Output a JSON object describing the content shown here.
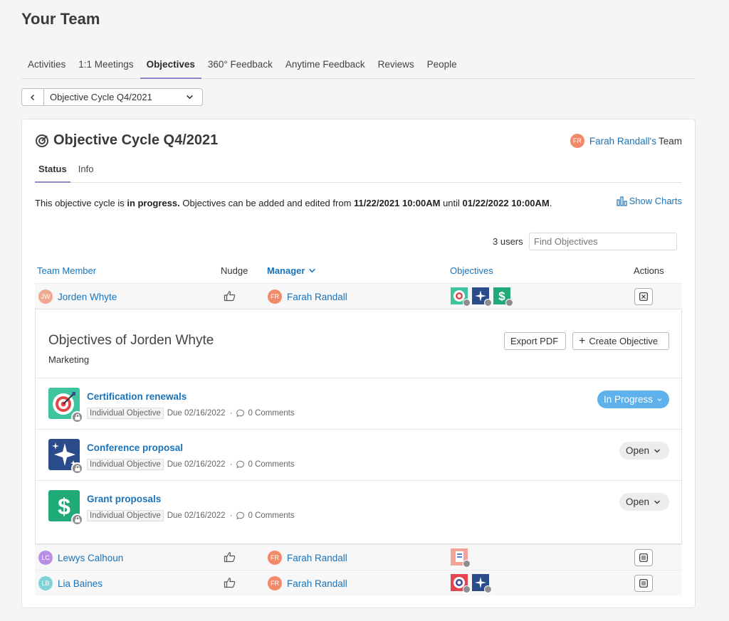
{
  "page": {
    "title": "Your Team"
  },
  "tabs": [
    {
      "label": "Activities",
      "active": false
    },
    {
      "label": "1:1 Meetings",
      "active": false
    },
    {
      "label": "Objectives",
      "active": true
    },
    {
      "label": "360° Feedback",
      "active": false
    },
    {
      "label": "Anytime Feedback",
      "active": false
    },
    {
      "label": "Reviews",
      "active": false
    },
    {
      "label": "People",
      "active": false
    }
  ],
  "cycle_selector": {
    "value": "Objective Cycle Q4/2021"
  },
  "cycle": {
    "title": "Objective Cycle Q4/2021",
    "owner_initials": "FR",
    "owner_name": "Farah Randall's",
    "owner_suffix": "Team",
    "subtabs": [
      {
        "label": "Status",
        "active": true
      },
      {
        "label": "Info",
        "active": false
      }
    ],
    "status": {
      "p1": "This objective cycle is ",
      "b1": "in progress.",
      "p2": " Objectives can be added and edited from ",
      "b2": "11/22/2021 10:00AM",
      "p3": " until ",
      "b3": "01/22/2022 10:00AM",
      "p4": "."
    },
    "show_charts": "Show Charts"
  },
  "list": {
    "users_count": "3 users",
    "search_placeholder": "Find Objectives",
    "headers": {
      "member": "Team Member",
      "nudge": "Nudge",
      "manager": "Manager",
      "objectives": "Objectives",
      "actions": "Actions"
    },
    "rows": [
      {
        "initials": "JW",
        "name": "Jorden Whyte",
        "manager_initials": "FR",
        "manager": "Farah Randall"
      },
      {
        "initials": "LC",
        "name": "Lewys Calhoun",
        "manager_initials": "FR",
        "manager": "Farah Randall"
      },
      {
        "initials": "LB",
        "name": "Lia Baines",
        "manager_initials": "FR",
        "manager": "Farah Randall"
      }
    ]
  },
  "detail": {
    "title": "Objectives of Jorden Whyte",
    "subtitle": "Marketing",
    "export_label": "Export PDF",
    "create_label": "Create Objective",
    "objectives": [
      {
        "name": "Certification renewals",
        "type": "Individual Objective",
        "due": "Due 02/16/2022",
        "comments": "0 Comments",
        "status": "In Progress",
        "icon": "target-icon"
      },
      {
        "name": "Conference proposal",
        "type": "Individual Objective",
        "due": "Due 02/16/2022",
        "comments": "0 Comments",
        "status": "Open",
        "icon": "sparkles-icon"
      },
      {
        "name": "Grant proposals",
        "type": "Individual Objective",
        "due": "Due 02/16/2022",
        "comments": "0 Comments",
        "status": "Open",
        "icon": "dollar-icon"
      }
    ]
  },
  "colors": {
    "link": "#1a73b8",
    "tab_underline": "#8e88c8",
    "in_progress": "#5fb1ec",
    "avatar_fr": "#f28a6a",
    "avatar_jw": "#f0a98e",
    "avatar_lc": "#b98de6",
    "avatar_lb": "#7fd3d6"
  }
}
